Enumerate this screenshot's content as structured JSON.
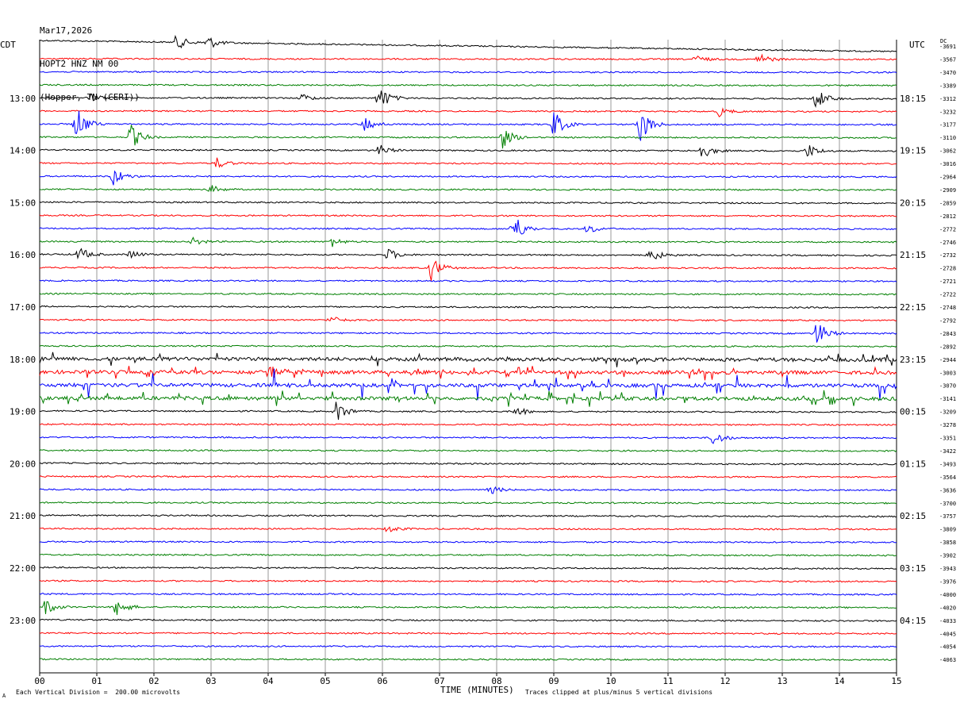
{
  "header": {
    "date": "Mar17,2026",
    "station": "HOPT2 HNZ NM 00",
    "location": "(Hopper, TN (CERI))"
  },
  "left_tz": "CDT",
  "right_tz": "UTC",
  "dc_label": "DC",
  "footer": {
    "xlabel": "TIME (MINUTES)",
    "scale_note": "Each Vertical Division =  200.00 microvolts",
    "clip_note": "Traces clipped at plus/minus 5 vertical divisions",
    "mark": "A"
  },
  "colors": {
    "trace_cycle": [
      "#000000",
      "#ff0000",
      "#0000ff",
      "#007f00"
    ],
    "grid": "#808080"
  },
  "chart_data": {
    "type": "line",
    "title": "HOPT2 HNZ NM 00",
    "xlabel": "TIME (MINUTES)",
    "xlim": [
      0,
      15
    ],
    "x_ticks": [
      "00",
      "01",
      "02",
      "03",
      "04",
      "05",
      "06",
      "07",
      "08",
      "09",
      "10",
      "11",
      "12",
      "13",
      "14",
      "15"
    ],
    "left_hour_labels": [
      {
        "row": 4,
        "text": "13:00"
      },
      {
        "row": 8,
        "text": "14:00"
      },
      {
        "row": 12,
        "text": "15:00"
      },
      {
        "row": 16,
        "text": "16:00"
      },
      {
        "row": 20,
        "text": "17:00"
      },
      {
        "row": 24,
        "text": "18:00"
      },
      {
        "row": 28,
        "text": "19:00"
      },
      {
        "row": 32,
        "text": "20:00"
      },
      {
        "row": 36,
        "text": "21:00"
      },
      {
        "row": 40,
        "text": "22:00"
      },
      {
        "row": 44,
        "text": "23:00"
      }
    ],
    "right_hour_labels": [
      {
        "row": 4,
        "text": "18:15"
      },
      {
        "row": 8,
        "text": "19:15"
      },
      {
        "row": 12,
        "text": "20:15"
      },
      {
        "row": 16,
        "text": "21:15"
      },
      {
        "row": 20,
        "text": "22:15"
      },
      {
        "row": 24,
        "text": "23:15"
      },
      {
        "row": 28,
        "text": "00:15"
      },
      {
        "row": 32,
        "text": "01:15"
      },
      {
        "row": 36,
        "text": "02:15"
      },
      {
        "row": 40,
        "text": "03:15"
      },
      {
        "row": 44,
        "text": "04:15"
      }
    ],
    "dc_offsets": [
      "-3691",
      "-3567",
      "-3470",
      "-3389",
      "-3312",
      "-3232",
      "-3177",
      "-3110",
      "-3062",
      "-3016",
      "-2964",
      "-2909",
      "-2859",
      "-2812",
      "-2772",
      "-2746",
      "-2732",
      "-2728",
      "-2721",
      "-2722",
      "-2748",
      "-2792",
      "-2843",
      "-2892",
      "-2944",
      "-3003",
      "-3070",
      "-3141",
      "-3209",
      "-3278",
      "-3351",
      "-3422",
      "-3493",
      "-3564",
      "-3636",
      "-3700",
      "-3757",
      "-3809",
      "-3858",
      "-3902",
      "-3943",
      "-3976",
      "-4000",
      "-4020",
      "-4033",
      "-4045",
      "-4054",
      "-4063"
    ],
    "events": [
      {
        "row": 0,
        "minute": 2.4,
        "amp": 10
      },
      {
        "row": 0,
        "minute": 2.95,
        "amp": 9
      },
      {
        "row": 1,
        "minute": 12.6,
        "amp": 8
      },
      {
        "row": 1,
        "minute": 11.5,
        "amp": 5
      },
      {
        "row": 4,
        "minute": 5.95,
        "amp": 16
      },
      {
        "row": 4,
        "minute": 13.6,
        "amp": 14
      },
      {
        "row": 4,
        "minute": 0.9,
        "amp": 5
      },
      {
        "row": 4,
        "minute": 4.6,
        "amp": 5
      },
      {
        "row": 5,
        "minute": 11.9,
        "amp": 6
      },
      {
        "row": 6,
        "minute": 0.65,
        "amp": 22
      },
      {
        "row": 6,
        "minute": 10.5,
        "amp": 26
      },
      {
        "row": 6,
        "minute": 9.0,
        "amp": 18
      },
      {
        "row": 6,
        "minute": 5.7,
        "amp": 10
      },
      {
        "row": 7,
        "minute": 1.6,
        "amp": 16
      },
      {
        "row": 7,
        "minute": 8.1,
        "amp": 14
      },
      {
        "row": 8,
        "minute": 11.6,
        "amp": 10
      },
      {
        "row": 8,
        "minute": 13.45,
        "amp": 9
      },
      {
        "row": 8,
        "minute": 5.95,
        "amp": 7
      },
      {
        "row": 9,
        "minute": 3.1,
        "amp": 7
      },
      {
        "row": 10,
        "minute": 1.3,
        "amp": 12
      },
      {
        "row": 11,
        "minute": 3.0,
        "amp": 5
      },
      {
        "row": 14,
        "minute": 8.3,
        "amp": 20
      },
      {
        "row": 14,
        "minute": 9.6,
        "amp": 6
      },
      {
        "row": 15,
        "minute": 5.1,
        "amp": 7
      },
      {
        "row": 15,
        "minute": 2.7,
        "amp": 5
      },
      {
        "row": 16,
        "minute": 0.7,
        "amp": 9
      },
      {
        "row": 16,
        "minute": 6.1,
        "amp": 8
      },
      {
        "row": 16,
        "minute": 10.7,
        "amp": 9
      },
      {
        "row": 16,
        "minute": 1.6,
        "amp": 5
      },
      {
        "row": 17,
        "minute": 6.85,
        "amp": 16
      },
      {
        "row": 21,
        "minute": 5.1,
        "amp": 5
      },
      {
        "row": 22,
        "minute": 13.6,
        "amp": 18
      },
      {
        "row": 25,
        "minute": 4.0,
        "amp": 12
      },
      {
        "row": 28,
        "minute": 5.2,
        "amp": 14
      },
      {
        "row": 28,
        "minute": 8.35,
        "amp": 6
      },
      {
        "row": 30,
        "minute": 11.8,
        "amp": 10
      },
      {
        "row": 34,
        "minute": 7.9,
        "amp": 5
      },
      {
        "row": 37,
        "minute": 6.1,
        "amp": 5
      },
      {
        "row": 43,
        "minute": 0.1,
        "amp": 10
      },
      {
        "row": 43,
        "minute": 1.35,
        "amp": 12
      }
    ],
    "noisy_rows": [
      24,
      25,
      26,
      27
    ]
  }
}
